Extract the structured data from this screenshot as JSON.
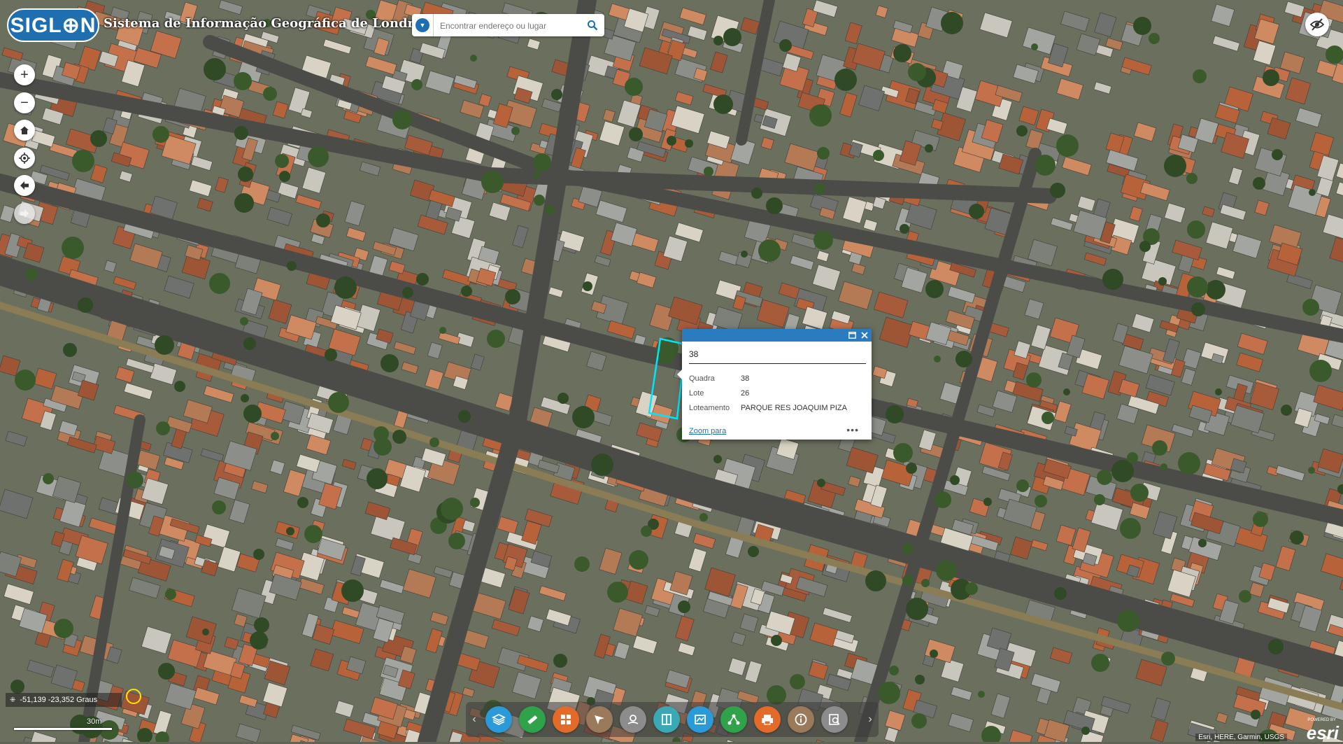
{
  "header": {
    "logo_text": "SIGL⊕N",
    "title": "Sistema de Informação Geográfica de Londrina"
  },
  "search": {
    "placeholder": "Encontrar endereço ou lugar"
  },
  "popup": {
    "title": "38",
    "fields": [
      {
        "label": "Quadra",
        "value": "38"
      },
      {
        "label": "Lote",
        "value": "26"
      },
      {
        "label": "Loteamento",
        "value": "PARQUE RES JOAQUIM PIZA"
      }
    ],
    "zoom_link": "Zoom para",
    "more": "•••"
  },
  "coordinates": "-51,139 -23,352 Graus",
  "scale_label": "30m",
  "attribution": "Esri, HERE, Garmin, USGS",
  "esri_logo": {
    "powered": "POWERED BY",
    "name": "esri"
  },
  "toolbar": {
    "buttons": [
      {
        "name": "layers-icon",
        "color": "#2b9ad8"
      },
      {
        "name": "measure-icon",
        "color": "#2fa24a"
      },
      {
        "name": "grid-icon",
        "color": "#e46a2a"
      },
      {
        "name": "draw-icon",
        "color": "#9b7a5c"
      },
      {
        "name": "location-icon",
        "color": "#8c8c8c"
      },
      {
        "name": "swipe-icon",
        "color": "#3aa9b6"
      },
      {
        "name": "compare-icon",
        "color": "#2b9ad8"
      },
      {
        "name": "share-icon",
        "color": "#2fa24a"
      },
      {
        "name": "print-icon",
        "color": "#e46a2a"
      },
      {
        "name": "info-icon",
        "color": "#9b7a5c"
      },
      {
        "name": "query-icon",
        "color": "#8c8c8c"
      }
    ]
  },
  "colors": {
    "accent": "#1f6fb0",
    "popup_bar": "#2b7bc0",
    "parcel_highlight": "#00e5ff"
  }
}
